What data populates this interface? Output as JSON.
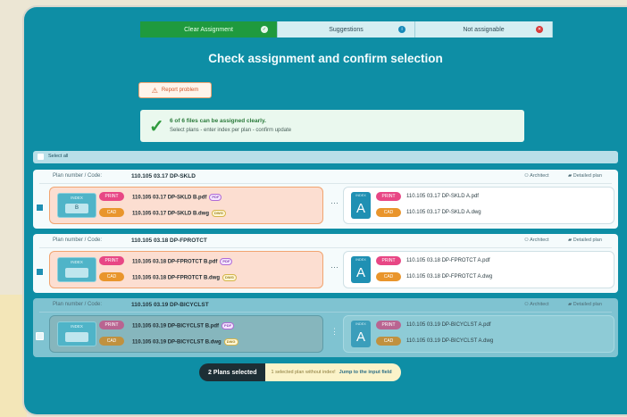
{
  "tabs": [
    {
      "label": "Clear Assignment",
      "icon": "check-icon",
      "glyph": "✓"
    },
    {
      "label": "Suggestions",
      "icon": "info-icon",
      "glyph": "i"
    },
    {
      "label": "Not assignable",
      "icon": "close-icon",
      "glyph": "✕"
    }
  ],
  "heading": "Check assignment and confirm selection",
  "report_label": "Report problem",
  "status": {
    "line1": "6 of 6 files can be assigned clearly.",
    "line2": "Select plans - enter index per plan - confirm update"
  },
  "select_all": "Select all",
  "plans": [
    {
      "header_label": "Plan number / Code:",
      "code": "110.105 03.17 DP-SKLD",
      "architect": "Architect",
      "detailed": "Detailed plan",
      "index_title": "INDEX",
      "index_value": "B",
      "print_label": "PRINT",
      "cad_label": "CAD",
      "print_file": "110.105 03.17 DP-SKLD",
      "print_ext": "B.pdf",
      "print_tag": "PDF",
      "cad_file": "110.105 03.17 DP-SKLD",
      "cad_ext": "B.dwg",
      "cad_tag": "DWG",
      "ellipsis": "···",
      "new_index_title": "INDEX",
      "new_index": "A",
      "new_print_file": "110.105 03.17 DP-SKLD A.pdf",
      "new_cad_file": "110.105 03.17 DP-SKLD A.dwg"
    },
    {
      "header_label": "Plan number / Code:",
      "code": "110.105 03.18 DP-FPROTCT",
      "architect": "Architect",
      "detailed": "Detailed plan",
      "index_title": "INDEX",
      "index_value": "",
      "print_label": "PRINT",
      "cad_label": "CAD",
      "print_file": "110.105 03.18 DP-FPROTCT",
      "print_ext": "B.pdf",
      "print_tag": "PDF",
      "cad_file": "110.105 03.18 DP-FPROTCT",
      "cad_ext": "B.dwg",
      "cad_tag": "DWG",
      "ellipsis": "···",
      "new_index_title": "INDEX",
      "new_index": "A",
      "new_print_file": "110.105 03.18 DP-FPROTCT A.pdf",
      "new_cad_file": "110.105 03.18 DP-FPROTCT A.dwg"
    },
    {
      "header_label": "Plan number / Code:",
      "code": "110.105 03.19 DP-BICYCLST",
      "architect": "Architect",
      "detailed": "Detailed plan",
      "index_title": "INDEX",
      "index_value": "",
      "print_label": "PRINT",
      "cad_label": "CAD",
      "print_file": "110.105 03.19 DP-BICYCLST",
      "print_ext": "B.pdf",
      "print_tag": "PDF",
      "cad_file": "110.105 03.19 DP-BICYCLST",
      "cad_ext": "B.dwg",
      "cad_tag": "DWG",
      "ellipsis": "⋮",
      "new_index_title": "INDEX",
      "new_index": "A",
      "new_print_file": "110.105 03.19 DP-BICYCLST A.pdf",
      "new_cad_file": "110.105 03.19 DP-BICYCLST A.dwg"
    }
  ],
  "toast": {
    "count": "2 Plans selected",
    "note": "1 selected plan without index!",
    "jump": "Jump to the input field"
  },
  "colors": {
    "panel": "#0e8ea5",
    "active_tab": "#1f9a3e",
    "warning": "#f1a470",
    "print": "#e84785",
    "cad": "#e9952c"
  }
}
